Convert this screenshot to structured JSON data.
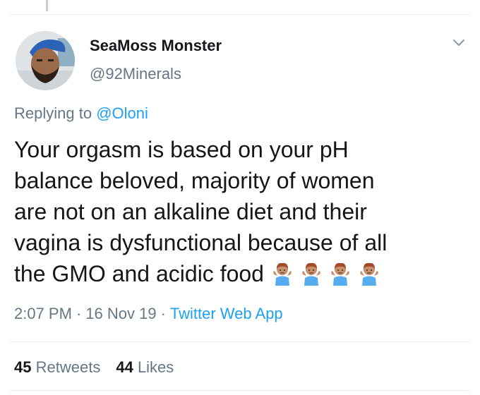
{
  "tweet": {
    "author": {
      "display_name": "SeaMoss Monster",
      "handle": "@92Minerals",
      "avatar_icon": "user-avatar-photo"
    },
    "menu_icon": "chevron-down-icon",
    "reply": {
      "prefix": "Replying to",
      "mention": "@Oloni"
    },
    "text_lines": [
      "Your orgasm is based on your pH",
      "balance beloved, majority of women",
      "are not on an alkaline diet and their",
      "vagina is dysfunctional because of all",
      "the GMO and acidic food"
    ],
    "emojis": [
      "man-shrugging-emoji",
      "man-shrugging-emoji",
      "man-shrugging-emoji",
      "man-shrugging-emoji"
    ],
    "time": "2:07 PM",
    "date": "16 Nov 19",
    "separator": "·",
    "source": "Twitter Web App",
    "stats": {
      "retweets_count": "45",
      "retweets_label": "Retweets",
      "likes_count": "44",
      "likes_label": "Likes"
    }
  },
  "colors": {
    "link": "#1da1f2",
    "secondary_text": "#657786",
    "primary_text": "#14171a",
    "divider": "#e6ecf0"
  }
}
